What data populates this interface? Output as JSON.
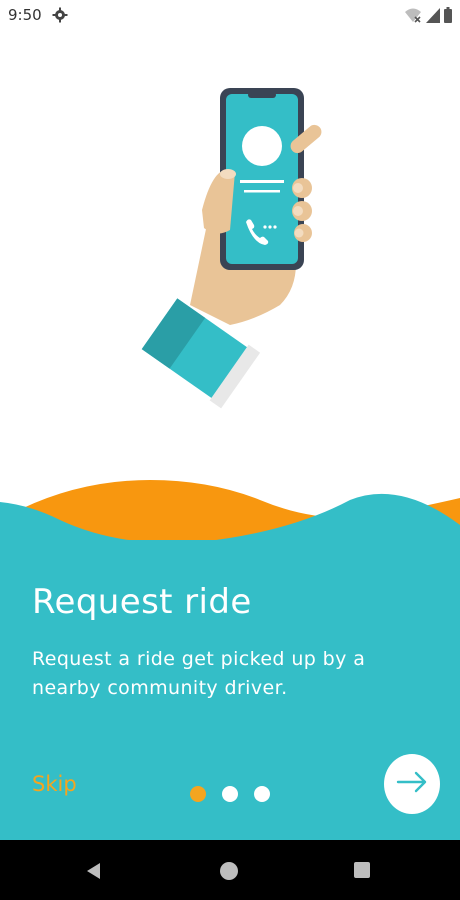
{
  "status_bar": {
    "time": "9:50",
    "icons": [
      "gear-icon",
      "wifi-off-icon",
      "signal-icon",
      "battery-icon"
    ]
  },
  "onboarding": {
    "title": "Request ride",
    "description": "Request a ride get picked up by a nearby community driver.",
    "skip_label": "Skip",
    "page_indicator": {
      "total": 3,
      "active": 1
    },
    "next_icon": "arrow-right-icon"
  },
  "colors": {
    "accent": "#34BEC7",
    "orange": "#F4A51F",
    "nav_bg": "#000000"
  },
  "nav_bar": {
    "icons": [
      "back-icon",
      "home-icon",
      "recents-icon"
    ]
  }
}
